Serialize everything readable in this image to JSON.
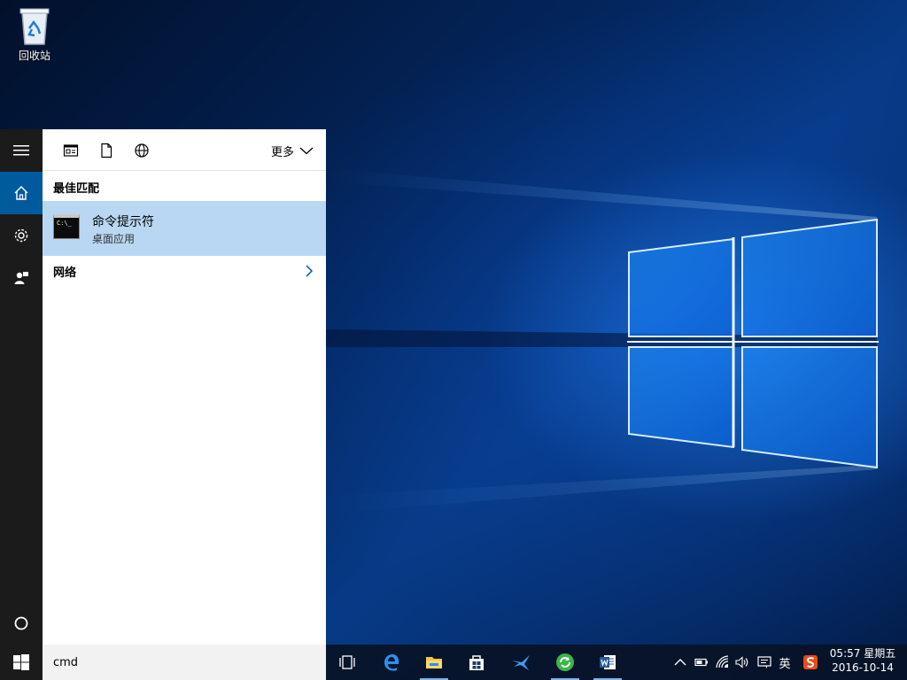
{
  "desktop": {
    "icons": [
      {
        "label": "回收站",
        "icon": "recycle-bin-icon"
      }
    ]
  },
  "search_panel": {
    "left_rail": [
      {
        "name": "hamburger-menu",
        "icon": "hamburger-icon"
      },
      {
        "name": "home",
        "icon": "home-icon",
        "active": true
      },
      {
        "name": "settings",
        "icon": "gear-icon"
      },
      {
        "name": "feedback",
        "icon": "person-feedback-icon"
      },
      {
        "name": "cortana",
        "icon": "circle-icon"
      }
    ],
    "toolbar": {
      "filters": [
        "apps-filter-icon",
        "documents-filter-icon",
        "web-filter-icon"
      ],
      "more_label": "更多"
    },
    "best_match_title": "最佳匹配",
    "best_match": {
      "name": "命令提示符",
      "subtitle": "桌面应用",
      "icon_text": "C:\\_"
    },
    "network_label": "网络"
  },
  "search_box": {
    "value": "cmd"
  },
  "taskbar": {
    "apps": [
      {
        "name": "task-view",
        "icon": "task-view-icon",
        "running": false
      },
      {
        "name": "edge",
        "icon": "edge-icon",
        "running": false
      },
      {
        "name": "file-explorer",
        "icon": "folder-icon",
        "running": true
      },
      {
        "name": "store",
        "icon": "store-icon",
        "running": false
      },
      {
        "name": "swallow-app",
        "icon": "bird-icon",
        "running": false
      },
      {
        "name": "green-refresh-app",
        "icon": "green-refresh-icon",
        "running": true
      },
      {
        "name": "word",
        "icon": "word-icon",
        "running": true
      }
    ],
    "tray": {
      "ime_label": "英",
      "time": "05:57 星期五",
      "date": "2016-10-14"
    }
  },
  "colors": {
    "accent": "#005a9e",
    "selection": "#b9d7f2",
    "rail": "#1b1b1b"
  }
}
